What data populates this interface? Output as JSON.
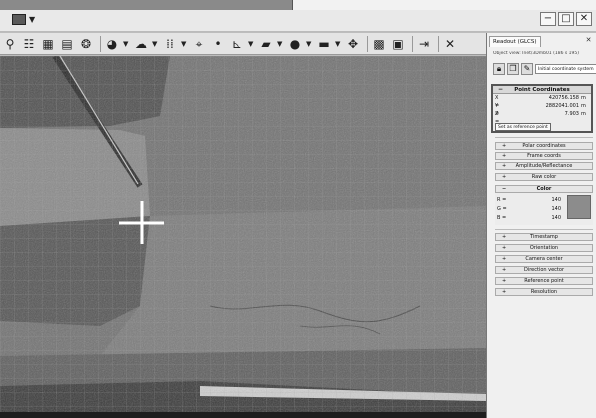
{
  "window": {
    "buttons": {
      "minimize": "−",
      "maximize": "□",
      "close": "✕"
    }
  },
  "toolbar": {
    "icons": [
      "pin-icon",
      "globe-data-icon",
      "grid-icon",
      "layers-icon",
      "settings-icon",
      "shape-icon",
      "cloud-icon",
      "raster-icon",
      "target-icon",
      "point-icon",
      "measure-icon",
      "stack-icon",
      "sphere-icon",
      "card-icon",
      "cross-tool-icon",
      "grid-table-icon",
      "export-icon",
      "exit-icon",
      "close-x-icon"
    ]
  },
  "readout_panel": {
    "tab_title": "Readout (GLCS)",
    "close_glyph": "✕",
    "context_text": "Object view: Inet/3Dmb01 (186 s 195)",
    "initial_coordinate_label": "Initial coordinate system",
    "point_coordinates": {
      "title": "Point Coordinates",
      "collapse_glyph": "−",
      "x_label": "X =",
      "x_value": "420756.158",
      "x_unit": "m",
      "y_label": "Y =",
      "y_value": "2882041.001",
      "y_unit": "m",
      "z_label": "Z =",
      "z_value": "7.903",
      "z_unit": "m",
      "ref_button": "Set as reference point"
    },
    "sections": [
      {
        "label": "Polar coordinates",
        "marker": "+"
      },
      {
        "label": "Frame coords",
        "marker": "+"
      },
      {
        "label": "Amplitude/Reflectance",
        "marker": "+"
      },
      {
        "label": "Raw color",
        "marker": "+"
      }
    ],
    "color": {
      "title": "Color",
      "marker": "−",
      "r_label": "R =",
      "r_value": "140",
      "g_label": "G =",
      "g_value": "140",
      "b_label": "B =",
      "b_value": "140",
      "swatch_color": "#8c8c8c"
    },
    "sections_after": [
      {
        "label": "Timestamp",
        "marker": "+"
      },
      {
        "label": "Orientation",
        "marker": "+"
      },
      {
        "label": "Camera center",
        "marker": "+"
      },
      {
        "label": "Direction vector",
        "marker": "+"
      },
      {
        "label": "Reference point",
        "marker": "+"
      },
      {
        "label": "Resolution",
        "marker": "+"
      }
    ]
  }
}
